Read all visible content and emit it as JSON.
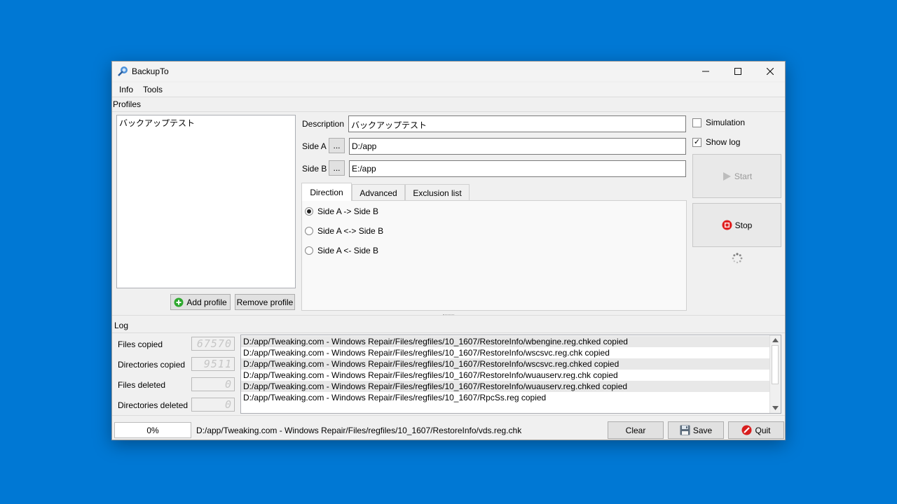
{
  "window": {
    "title": "BackupTo"
  },
  "menu": {
    "info": "Info",
    "tools": "Tools"
  },
  "profiles": {
    "section_label": "Profiles",
    "items": [
      "バックアップテスト"
    ],
    "add_label": "Add profile",
    "remove_label": "Remove profile"
  },
  "form": {
    "description_label": "Description",
    "description_value": "バックアップテスト",
    "side_a_label": "Side A",
    "side_a_value": "D:/app",
    "side_b_label": "Side B",
    "side_b_value": "E:/app",
    "browse_label": "..."
  },
  "tabs": [
    "Direction",
    "Advanced",
    "Exclusion list"
  ],
  "direction": {
    "options": [
      "Side A -> Side B",
      "Side A <-> Side B",
      "Side A <- Side B"
    ],
    "selected_index": 0
  },
  "options": {
    "simulation_label": "Simulation",
    "simulation_checked": false,
    "show_log_label": "Show log",
    "show_log_checked": true,
    "checkmark": "✓"
  },
  "actions": {
    "start_label": "Start",
    "stop_label": "Stop"
  },
  "log": {
    "section_label": "Log",
    "stats": [
      {
        "label": "Files copied",
        "value": "67570"
      },
      {
        "label": "Directories copied",
        "value": "9511"
      },
      {
        "label": "Files deleted",
        "value": "0"
      },
      {
        "label": "Directories deleted",
        "value": "0"
      }
    ],
    "lines": [
      "D:/app/Tweaking.com - Windows Repair/Files/regfiles/10_1607/RestoreInfo/wbengine.reg.chked copied",
      "D:/app/Tweaking.com - Windows Repair/Files/regfiles/10_1607/RestoreInfo/wscsvc.reg.chk copied",
      "D:/app/Tweaking.com - Windows Repair/Files/regfiles/10_1607/RestoreInfo/wscsvc.reg.chked copied",
      "D:/app/Tweaking.com - Windows Repair/Files/regfiles/10_1607/RestoreInfo/wuauserv.reg.chk copied",
      "D:/app/Tweaking.com - Windows Repair/Files/regfiles/10_1607/RestoreInfo/wuauserv.reg.chked copied",
      "D:/app/Tweaking.com - Windows Repair/Files/regfiles/10_1607/RpcSs.reg copied"
    ]
  },
  "status": {
    "progress_text": "0%",
    "progress_value": 0,
    "current_file": "D:/app/Tweaking.com - Windows Repair/Files/regfiles/10_1607/RestoreInfo/vds.reg.chk",
    "clear_label": "Clear",
    "save_label": "Save",
    "quit_label": "Quit"
  },
  "colors": {
    "desktop": "#0078d4",
    "stop_red": "#e02020",
    "add_green": "#2ea82e"
  }
}
